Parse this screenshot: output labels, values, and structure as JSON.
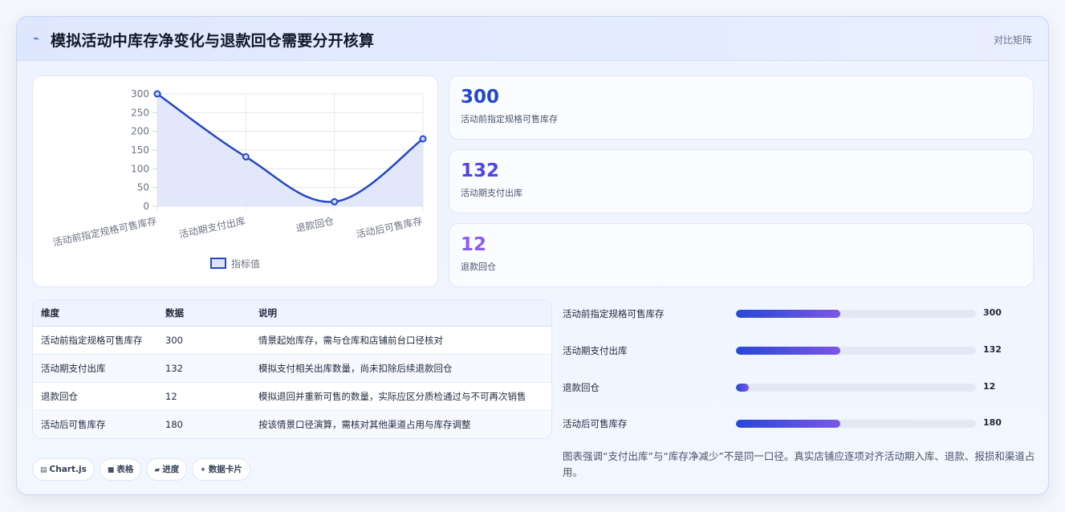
{
  "header": {
    "icon": "lightning-icon",
    "title": "模拟活动中库存净变化与退款回仓需要分开核算",
    "right_label": "对比矩阵"
  },
  "chart_data": {
    "type": "line",
    "categories": [
      "活动前指定规格可售库存",
      "活动期支付出库",
      "退款回仓",
      "活动后可售库存"
    ],
    "series": [
      {
        "name": "指标值",
        "values": [
          300,
          132,
          12,
          180
        ]
      }
    ],
    "yticks": [
      0,
      50,
      100,
      150,
      200,
      250,
      300
    ],
    "ylim": [
      0,
      300
    ],
    "grid": true,
    "legend": "bottom",
    "color": "#2347c8",
    "fill": "#dde4f8"
  },
  "kpis": [
    {
      "value": "300",
      "label": "活动前指定规格可售库存",
      "color": "#2347c8"
    },
    {
      "value": "132",
      "label": "活动期支付出库",
      "color": "#4f46e5"
    },
    {
      "value": "12",
      "label": "退款回仓",
      "color": "#8b5cf6"
    }
  ],
  "table": {
    "headers": [
      "维度",
      "数据",
      "说明"
    ],
    "rows": [
      [
        "活动前指定规格可售库存",
        "300",
        "情景起始库存，需与仓库和店铺前台口径核对"
      ],
      [
        "活动期支付出库",
        "132",
        "模拟支付相关出库数量，尚未扣除后续退款回仓"
      ],
      [
        "退款回仓",
        "12",
        "模拟退回并重新可售的数量，实际应区分质检通过与不可再次销售"
      ],
      [
        "活动后可售库存",
        "180",
        "按该情景口径演算，需核对其他渠道占用与库存调整"
      ]
    ]
  },
  "progress": [
    {
      "label": "活动前指定规格可售库存",
      "value": "300",
      "fraction": 0.435
    },
    {
      "label": "活动期支付出库",
      "value": "132",
      "fraction": 0.435
    },
    {
      "label": "退款回仓",
      "value": "12",
      "fraction": 0.054
    },
    {
      "label": "活动后可售库存",
      "value": "180",
      "fraction": 0.435
    }
  ],
  "note": "图表强调“支付出库”与“库存净减少”不是同一口径。真实店铺应逐项对齐活动期入库、退款、报损和渠道占用。",
  "chips": [
    {
      "icon": "chart-icon",
      "glyph": "▤",
      "label": "Chart.js"
    },
    {
      "icon": "table-icon",
      "glyph": "■",
      "label": "表格"
    },
    {
      "icon": "progress-icon",
      "glyph": "▰",
      "label": "进度"
    },
    {
      "icon": "sparkle-icon",
      "glyph": "✦",
      "label": "数据卡片"
    }
  ]
}
